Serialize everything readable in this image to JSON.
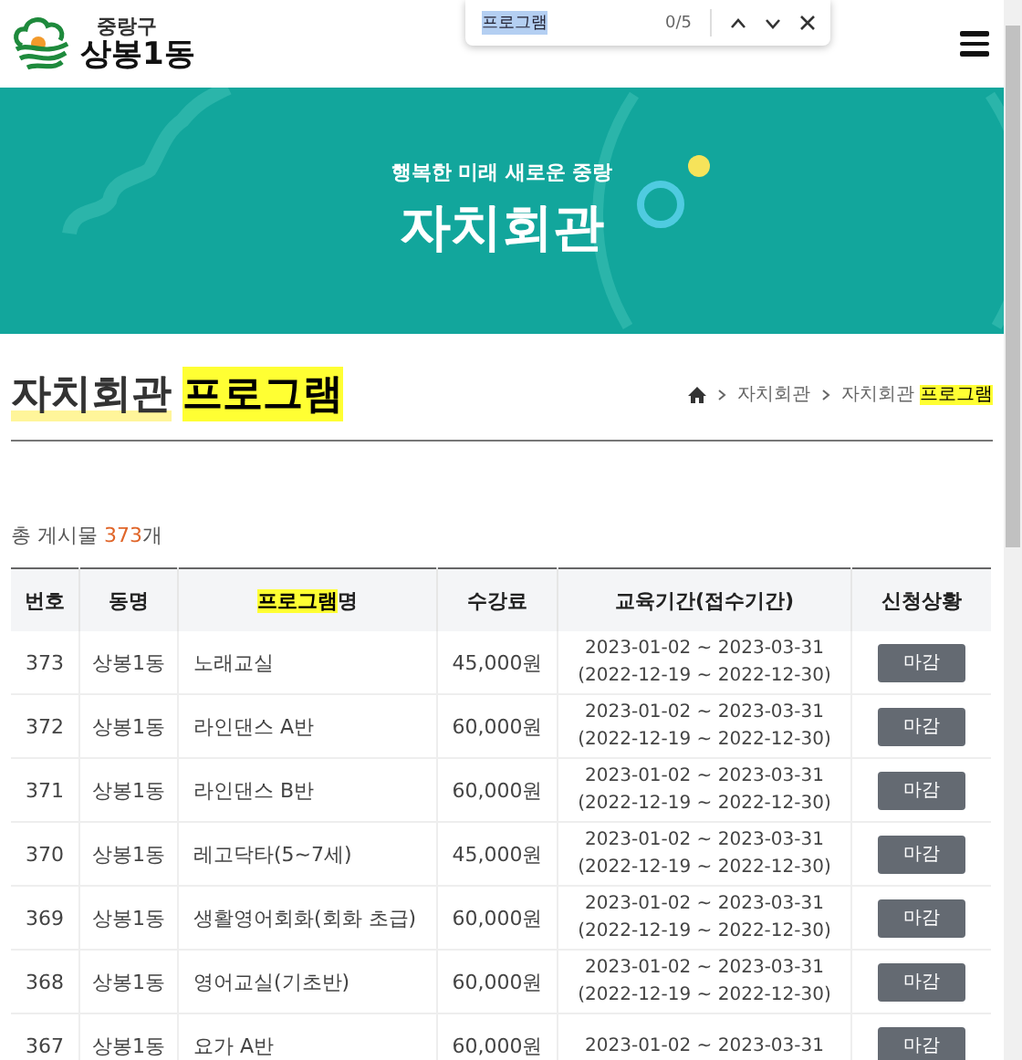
{
  "header": {
    "logo_district": "중랑구",
    "logo_name": "상봉1동"
  },
  "find_bar": {
    "query": "프로그램",
    "count": "0/5"
  },
  "banner": {
    "subtitle": "행복한 미래 새로운 중랑",
    "title": "자치회관"
  },
  "page_title": [
    {
      "text": "자치회관",
      "highlighted": false
    },
    {
      "text": "프로그램",
      "highlighted": true
    }
  ],
  "breadcrumb": [
    [
      {
        "text": "자치회관",
        "highlighted": false
      }
    ],
    [
      {
        "text": "자치회관 ",
        "highlighted": false
      },
      {
        "text": "프로그램",
        "highlighted": true
      }
    ]
  ],
  "total": {
    "label": "총 게시물",
    "count": "373",
    "suffix": "개"
  },
  "table": {
    "columns": [
      [
        {
          "text": "번호",
          "highlighted": false
        }
      ],
      [
        {
          "text": "동명",
          "highlighted": false
        }
      ],
      [
        {
          "text": "프로그램",
          "highlighted": true
        },
        {
          "text": "명",
          "highlighted": false
        }
      ],
      [
        {
          "text": "수강료",
          "highlighted": false
        }
      ],
      [
        {
          "text": "교육기간(접수기간)",
          "highlighted": false
        }
      ],
      [
        {
          "text": "신청상황",
          "highlighted": false
        }
      ]
    ],
    "rows": [
      {
        "no": "373",
        "dong": "상봉1동",
        "program": "노래교실",
        "fee": "45,000원",
        "period": "2023-01-02 ~ 2023-03-31",
        "application": "(2022-12-19 ~ 2022-12-30)",
        "status": "마감"
      },
      {
        "no": "372",
        "dong": "상봉1동",
        "program": "라인댄스 A반",
        "fee": "60,000원",
        "period": "2023-01-02 ~ 2023-03-31",
        "application": "(2022-12-19 ~ 2022-12-30)",
        "status": "마감"
      },
      {
        "no": "371",
        "dong": "상봉1동",
        "program": "라인댄스 B반",
        "fee": "60,000원",
        "period": "2023-01-02 ~ 2023-03-31",
        "application": "(2022-12-19 ~ 2022-12-30)",
        "status": "마감"
      },
      {
        "no": "370",
        "dong": "상봉1동",
        "program": "레고닥타(5~7세)",
        "fee": "45,000원",
        "period": "2023-01-02 ~ 2023-03-31",
        "application": "(2022-12-19 ~ 2022-12-30)",
        "status": "마감"
      },
      {
        "no": "369",
        "dong": "상봉1동",
        "program": "생활영어회화(회화 초급)",
        "fee": "60,000원",
        "period": "2023-01-02 ~ 2023-03-31",
        "application": "(2022-12-19 ~ 2022-12-30)",
        "status": "마감"
      },
      {
        "no": "368",
        "dong": "상봉1동",
        "program": "영어교실(기초반)",
        "fee": "60,000원",
        "period": "2023-01-02 ~ 2023-03-31",
        "application": "(2022-12-19 ~ 2022-12-30)",
        "status": "마감"
      },
      {
        "no": "367",
        "dong": "상봉1동",
        "program": "요가 A반",
        "fee": "60,000원",
        "period": "2023-01-02 ~ 2023-03-31",
        "status": "마감"
      }
    ]
  }
}
